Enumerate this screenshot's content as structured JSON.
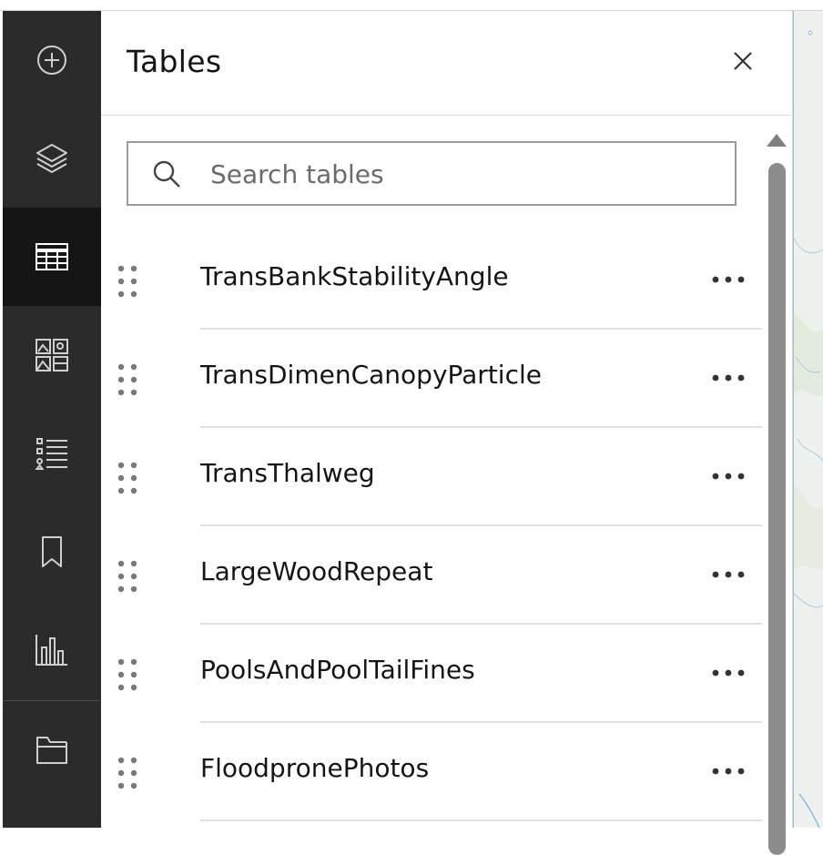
{
  "panel": {
    "title": "Tables",
    "close_icon": "close-icon"
  },
  "search": {
    "placeholder": "Search tables",
    "value": "",
    "icon": "search-icon"
  },
  "action_bar": {
    "items": [
      {
        "name": "add",
        "icon": "add-circle-icon",
        "active": false
      },
      {
        "name": "layers",
        "icon": "layers-icon",
        "active": false
      },
      {
        "name": "tables",
        "icon": "table-icon",
        "active": true
      },
      {
        "name": "basemap",
        "icon": "basemap-gallery-icon",
        "active": false
      },
      {
        "name": "legend",
        "icon": "legend-list-icon",
        "active": false
      },
      {
        "name": "bookmarks",
        "icon": "bookmark-icon",
        "active": false
      },
      {
        "name": "charts",
        "icon": "bar-chart-icon",
        "active": false
      },
      {
        "name": "folder",
        "icon": "folder-icon",
        "active": false
      }
    ]
  },
  "tables": [
    {
      "label": "TransBankStabilityAngle"
    },
    {
      "label": "TransDimenCanopyParticle"
    },
    {
      "label": "TransThalweg"
    },
    {
      "label": "LargeWoodRepeat"
    },
    {
      "label": "PoolsAndPoolTailFines"
    },
    {
      "label": "FloodpronePhotos"
    }
  ],
  "row_icons": {
    "drag": "drag-handle-icon",
    "more": "more-options-icon"
  },
  "colors": {
    "action_bar_bg": "#2b2b2b",
    "action_bar_active": "#151515",
    "icon_light": "#c8c8c8",
    "text": "#151515"
  }
}
